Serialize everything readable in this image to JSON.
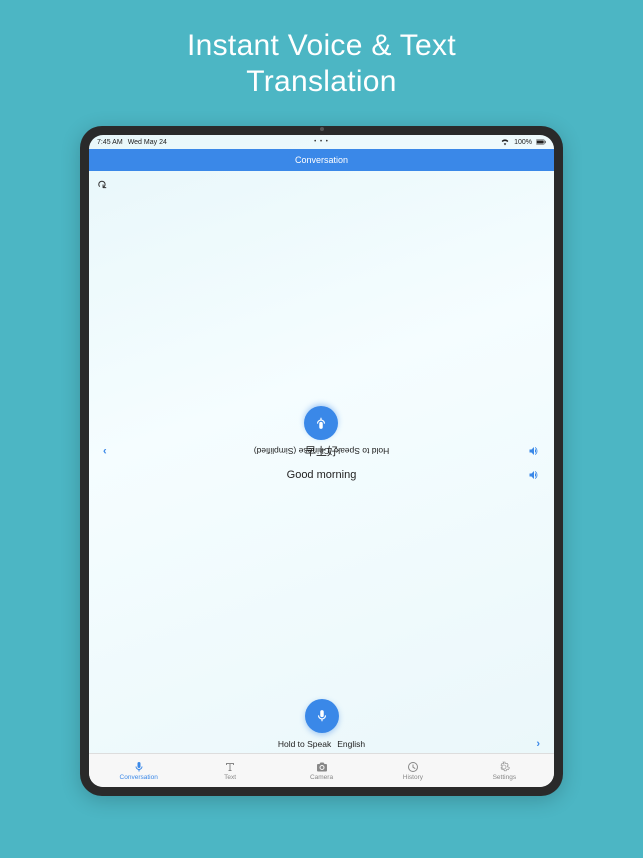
{
  "marketing": {
    "headline_line1": "Instant Voice & Text",
    "headline_line2": "Translation"
  },
  "status_bar": {
    "time": "7:45 AM",
    "date": "Wed May 24",
    "battery_text": "100%"
  },
  "nav": {
    "title": "Conversation"
  },
  "top_side": {
    "hold_label": "Hold to Speak",
    "language": "Chinese (Simplified)"
  },
  "bottom_side": {
    "hold_label": "Hold to Speak",
    "language": "English"
  },
  "translation": {
    "target_text": "早上好",
    "source_text": "Good morning"
  },
  "tabs": {
    "conversation": "Conversation",
    "text": "Text",
    "camera": "Camera",
    "history": "History",
    "settings": "Settings"
  }
}
